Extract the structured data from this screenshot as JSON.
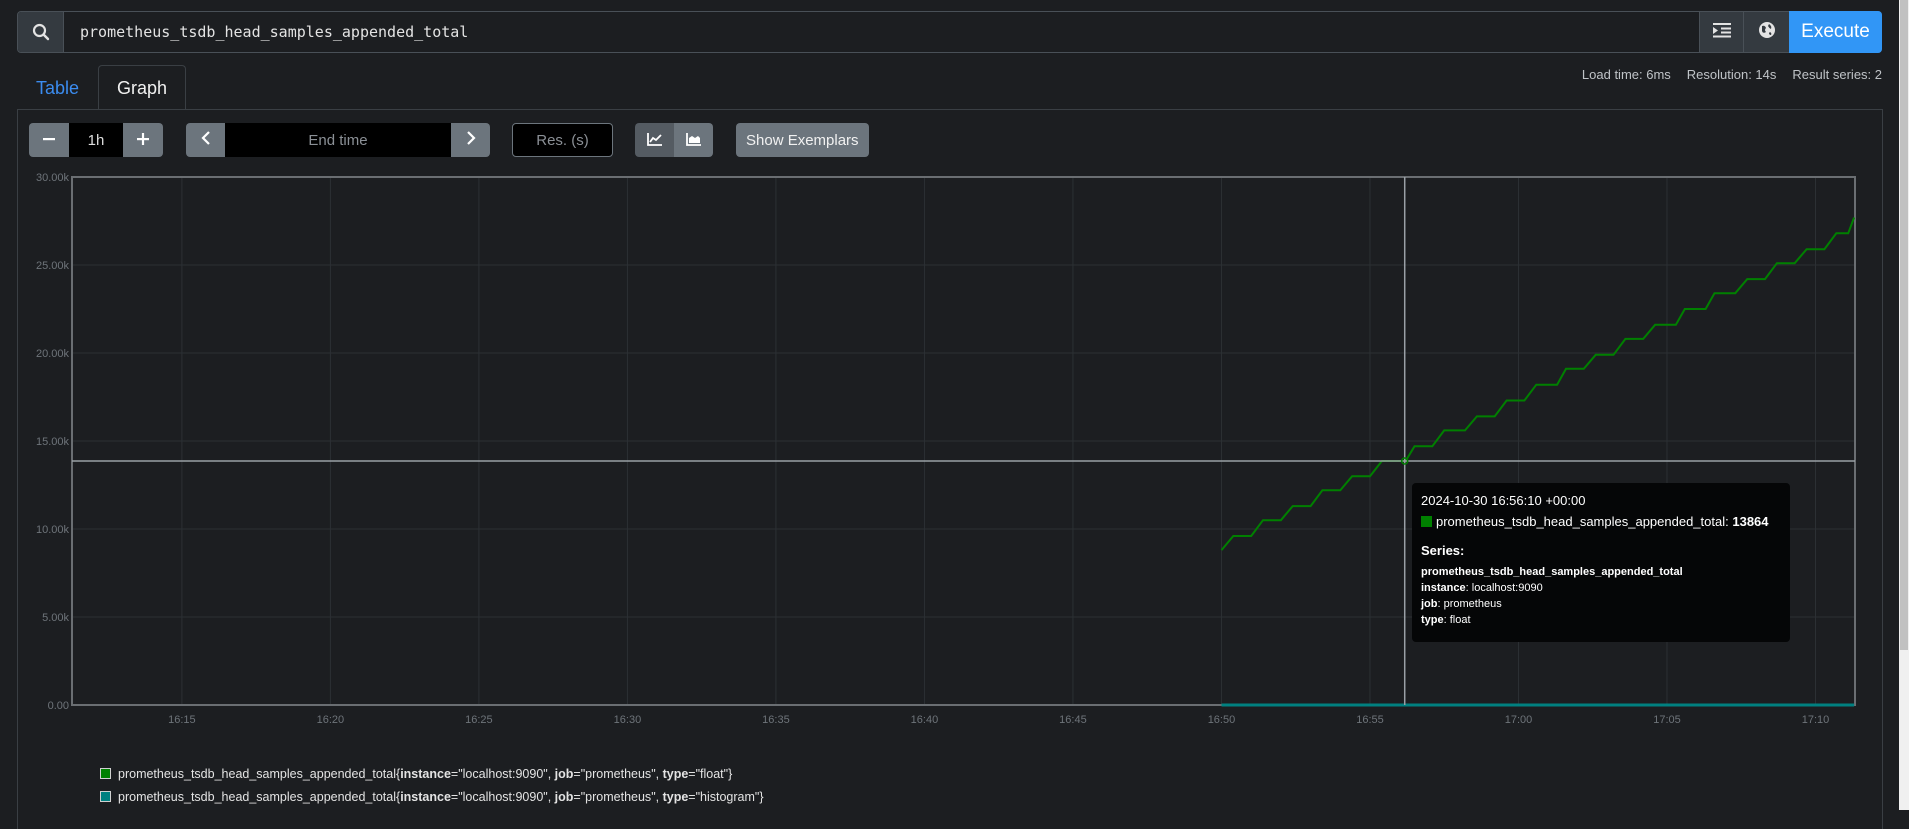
{
  "query": {
    "value": "prometheus_tsdb_head_samples_appended_total",
    "execute_label": "Execute",
    "search_icon": "search-icon",
    "format_icon": "indent-icon",
    "metrics_explorer_icon": "globe-icon"
  },
  "tabs": [
    {
      "label": "Table",
      "active": false
    },
    {
      "label": "Graph",
      "active": true
    }
  ],
  "stats": {
    "load_time": "Load time: 6ms",
    "resolution": "Resolution: 14s",
    "result_series": "Result series: 2"
  },
  "controls": {
    "decrease_icon": "minus-icon",
    "range_value": "1h",
    "increase_icon": "plus-icon",
    "prev_icon": "chevron-left-icon",
    "end_time_placeholder": "End time",
    "next_icon": "chevron-right-icon",
    "resolution_placeholder": "Res. (s)",
    "unstacked_icon": "line-chart-icon",
    "stacked_icon": "area-chart-icon",
    "show_exemplars_label": "Show Exemplars"
  },
  "tooltip": {
    "time": "2024-10-30 16:56:10 +00:00",
    "metric": "prometheus_tsdb_head_samples_appended_total",
    "value": "13864",
    "series_heading": "Series:",
    "series_name": "prometheus_tsdb_head_samples_appended_total",
    "labels": [
      {
        "key": "instance",
        "value": "localhost:9090"
      },
      {
        "key": "job",
        "value": "prometheus"
      },
      {
        "key": "type",
        "value": "float"
      }
    ]
  },
  "legend": [
    {
      "metric": "prometheus_tsdb_head_samples_appended_total",
      "labels": [
        {
          "key": "instance",
          "value": "localhost:9090"
        },
        {
          "key": "job",
          "value": "prometheus"
        },
        {
          "key": "type",
          "value": "float"
        }
      ],
      "color": "#008000"
    },
    {
      "metric": "prometheus_tsdb_head_samples_appended_total",
      "labels": [
        {
          "key": "instance",
          "value": "localhost:9090"
        },
        {
          "key": "job",
          "value": "prometheus"
        },
        {
          "key": "type",
          "value": "histogram"
        }
      ],
      "color": "#008080"
    }
  ],
  "chart_data": {
    "type": "line",
    "title": "",
    "xlabel": "",
    "ylabel": "",
    "x_range": [
      "16:11:18",
      "17:11:20"
    ],
    "xlim_minutes": [
      -38.7,
      21.33
    ],
    "ylim": [
      0,
      30000
    ],
    "y_ticks": [
      "0.00",
      "5.00k",
      "10.00k",
      "15.00k",
      "20.00k",
      "25.00k",
      "30.00k"
    ],
    "y_tick_values": [
      0,
      5000,
      10000,
      15000,
      20000,
      25000,
      30000
    ],
    "x_ticks": [
      "16:15",
      "16:20",
      "16:25",
      "16:30",
      "16:35",
      "16:40",
      "16:45",
      "16:50",
      "16:55",
      "17:00",
      "17:05",
      "17:10"
    ],
    "x_tick_minutes": [
      -35,
      -30,
      -25,
      -20,
      -15,
      -10,
      -5,
      0,
      5,
      10,
      15,
      20
    ],
    "grid": true,
    "crosshair": {
      "time_minutes": 6.17,
      "value": 13864
    },
    "series": [
      {
        "name": "prometheus_tsdb_head_samples_appended_total{instance=\"localhost:9090\", job=\"prometheus\", type=\"float\"}",
        "color": "#008000",
        "step_start_minute": 0,
        "start_value": 8800,
        "step_size": 900,
        "steps_per_minute": 1,
        "end_minute": 21.3,
        "points": [
          [
            0.0,
            8800
          ],
          [
            0.4,
            9600
          ],
          [
            1.0,
            9600
          ],
          [
            1.4,
            10500
          ],
          [
            2.0,
            10500
          ],
          [
            2.4,
            11300
          ],
          [
            3.0,
            11300
          ],
          [
            3.4,
            12200
          ],
          [
            4.0,
            12200
          ],
          [
            4.4,
            13000
          ],
          [
            5.0,
            13000
          ],
          [
            5.4,
            13864
          ],
          [
            6.2,
            13864
          ],
          [
            6.5,
            14700
          ],
          [
            7.1,
            14700
          ],
          [
            7.5,
            15600
          ],
          [
            8.2,
            15600
          ],
          [
            8.6,
            16400
          ],
          [
            9.2,
            16400
          ],
          [
            9.6,
            17300
          ],
          [
            10.2,
            17300
          ],
          [
            10.6,
            18200
          ],
          [
            11.3,
            18200
          ],
          [
            11.6,
            19100
          ],
          [
            12.2,
            19100
          ],
          [
            12.6,
            19900
          ],
          [
            13.2,
            19900
          ],
          [
            13.6,
            20800
          ],
          [
            14.2,
            20800
          ],
          [
            14.6,
            21600
          ],
          [
            15.3,
            21600
          ],
          [
            15.6,
            22500
          ],
          [
            16.3,
            22500
          ],
          [
            16.6,
            23400
          ],
          [
            17.3,
            23400
          ],
          [
            17.7,
            24200
          ],
          [
            18.3,
            24200
          ],
          [
            18.7,
            25100
          ],
          [
            19.3,
            25100
          ],
          [
            19.7,
            25900
          ],
          [
            20.3,
            25900
          ],
          [
            20.7,
            26800
          ],
          [
            21.1,
            26800
          ],
          [
            21.3,
            27700
          ]
        ]
      },
      {
        "name": "prometheus_tsdb_head_samples_appended_total{instance=\"localhost:9090\", job=\"prometheus\", type=\"histogram\"}",
        "color": "#008080",
        "points": [
          [
            0.0,
            0
          ],
          [
            21.3,
            0
          ]
        ]
      }
    ]
  }
}
